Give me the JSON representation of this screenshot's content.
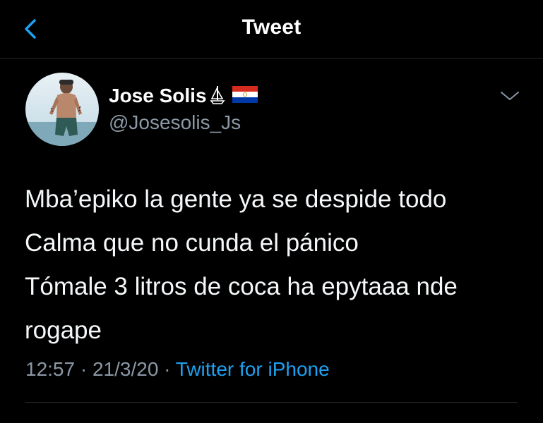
{
  "nav": {
    "title": "Tweet"
  },
  "author": {
    "display_name": "Jose Solis",
    "handle": "@Josesolis_Js"
  },
  "tweet": {
    "lines": [
      "Mba’epiko la gente ya se despide todo",
      "Calma que no cunda el pánico",
      "Tómale 3 litros de coca ha epytaaa nde",
      "rogape"
    ]
  },
  "meta": {
    "time": "12:57",
    "separator": "·",
    "date": "21/3/20",
    "source": "Twitter for iPhone"
  },
  "icons": {
    "back": "chevron-left-icon",
    "more": "chevron-down-icon",
    "emoji_1": "sailboat-icon",
    "emoji_2": "paraguay-flag-icon"
  },
  "colors": {
    "background": "#000000",
    "accent": "#1da1f2",
    "secondary_text": "#8b98a5",
    "primary_text": "#ffffff"
  }
}
